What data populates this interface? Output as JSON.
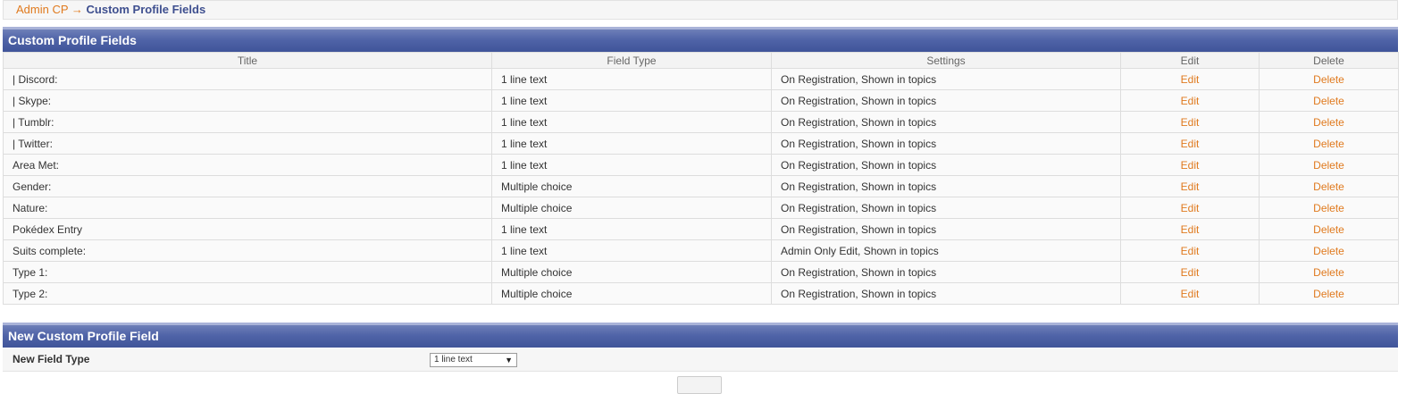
{
  "breadcrumb": {
    "home": "Admin CP",
    "arrow": "→",
    "current": "Custom Profile Fields"
  },
  "fields_panel": {
    "title": "Custom Profile Fields",
    "columns": [
      "Title",
      "Field Type",
      "Settings",
      "Edit",
      "Delete"
    ],
    "rows": [
      {
        "title": "| Discord:",
        "type": "1 line text",
        "settings": "On Registration, Shown in topics",
        "edit": "Edit",
        "delete": "Delete"
      },
      {
        "title": "| Skype:",
        "type": "1 line text",
        "settings": "On Registration, Shown in topics",
        "edit": "Edit",
        "delete": "Delete"
      },
      {
        "title": "| Tumblr:",
        "type": "1 line text",
        "settings": "On Registration, Shown in topics",
        "edit": "Edit",
        "delete": "Delete"
      },
      {
        "title": "| Twitter:",
        "type": "1 line text",
        "settings": "On Registration, Shown in topics",
        "edit": "Edit",
        "delete": "Delete"
      },
      {
        "title": "Area Met:",
        "type": "1 line text",
        "settings": "On Registration, Shown in topics",
        "edit": "Edit",
        "delete": "Delete"
      },
      {
        "title": "Gender:",
        "type": "Multiple choice",
        "settings": "On Registration, Shown in topics",
        "edit": "Edit",
        "delete": "Delete"
      },
      {
        "title": "Nature:",
        "type": "Multiple choice",
        "settings": "On Registration, Shown in topics",
        "edit": "Edit",
        "delete": "Delete"
      },
      {
        "title": "Pokédex Entry",
        "type": "1 line text",
        "settings": "On Registration, Shown in topics",
        "edit": "Edit",
        "delete": "Delete"
      },
      {
        "title": "Suits complete:",
        "type": "1 line text",
        "settings": "Admin Only Edit, Shown in topics",
        "edit": "Edit",
        "delete": "Delete"
      },
      {
        "title": "Type 1:",
        "type": "Multiple choice",
        "settings": "On Registration, Shown in topics",
        "edit": "Edit",
        "delete": "Delete"
      },
      {
        "title": "Type 2:",
        "type": "Multiple choice",
        "settings": "On Registration, Shown in topics",
        "edit": "Edit",
        "delete": "Delete"
      }
    ]
  },
  "new_field_panel": {
    "title": "New Custom Profile Field",
    "label": "New Field Type",
    "select_value": "1 line text"
  },
  "colors": {
    "link": "#e07a1e",
    "header_blue": "#5064a8",
    "breadcrumb_current": "#3e4f8f"
  }
}
